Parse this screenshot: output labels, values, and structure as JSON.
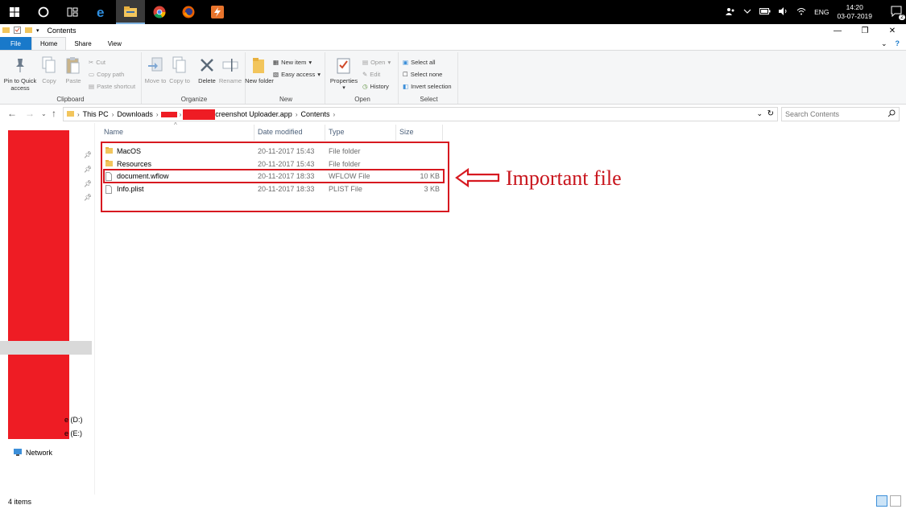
{
  "window": {
    "title": "Contents"
  },
  "taskbar": {
    "tray": {
      "lang": "ENG",
      "time": "14:20",
      "date": "03-07-2019",
      "notif_count": "2"
    }
  },
  "ribbon": {
    "tabs": [
      "File",
      "Home",
      "Share",
      "View"
    ],
    "clipboard": {
      "label": "Clipboard",
      "pin": "Pin to Quick access",
      "copy": "Copy",
      "paste": "Paste",
      "cut": "Cut",
      "copy_path": "Copy path",
      "paste_shortcut": "Paste shortcut"
    },
    "organize": {
      "label": "Organize",
      "move_to": "Move to",
      "copy_to": "Copy to",
      "delete": "Delete",
      "rename": "Rename"
    },
    "new": {
      "label": "New",
      "new_folder": "New folder",
      "new_item": "New item",
      "easy_access": "Easy access"
    },
    "open": {
      "label": "Open",
      "properties": "Properties",
      "open": "Open",
      "edit": "Edit",
      "history": "History"
    },
    "select": {
      "label": "Select",
      "select_all": "Select all",
      "select_none": "Select none",
      "invert_selection": "Invert selection"
    }
  },
  "address": {
    "crumbs": [
      "This PC",
      "Downloads",
      "creenshot Uploader.app",
      "Contents"
    ],
    "search_placeholder": "Search Contents"
  },
  "navpane": {
    "drive_d": "e (D:)",
    "drive_e": "e (E:)",
    "network": "Network"
  },
  "columns": [
    "Name",
    "Date modified",
    "Type",
    "Size"
  ],
  "files": [
    {
      "name": "MacOS",
      "date": "20-11-2017 15:43",
      "type": "File folder",
      "size": "",
      "kind": "folder"
    },
    {
      "name": "Resources",
      "date": "20-11-2017 15:43",
      "type": "File folder",
      "size": "",
      "kind": "folder"
    },
    {
      "name": "document.wflow",
      "date": "20-11-2017 18:33",
      "type": "WFLOW File",
      "size": "10 KB",
      "kind": "file"
    },
    {
      "name": "Info.plist",
      "date": "20-11-2017 18:33",
      "type": "PLIST File",
      "size": "3 KB",
      "kind": "file"
    }
  ],
  "annotation": {
    "text": "Important file",
    "color": "#c8141c"
  },
  "status": {
    "count": "4 items"
  },
  "colors": {
    "accent": "#1979ca",
    "redaction": "#ee1c24"
  }
}
